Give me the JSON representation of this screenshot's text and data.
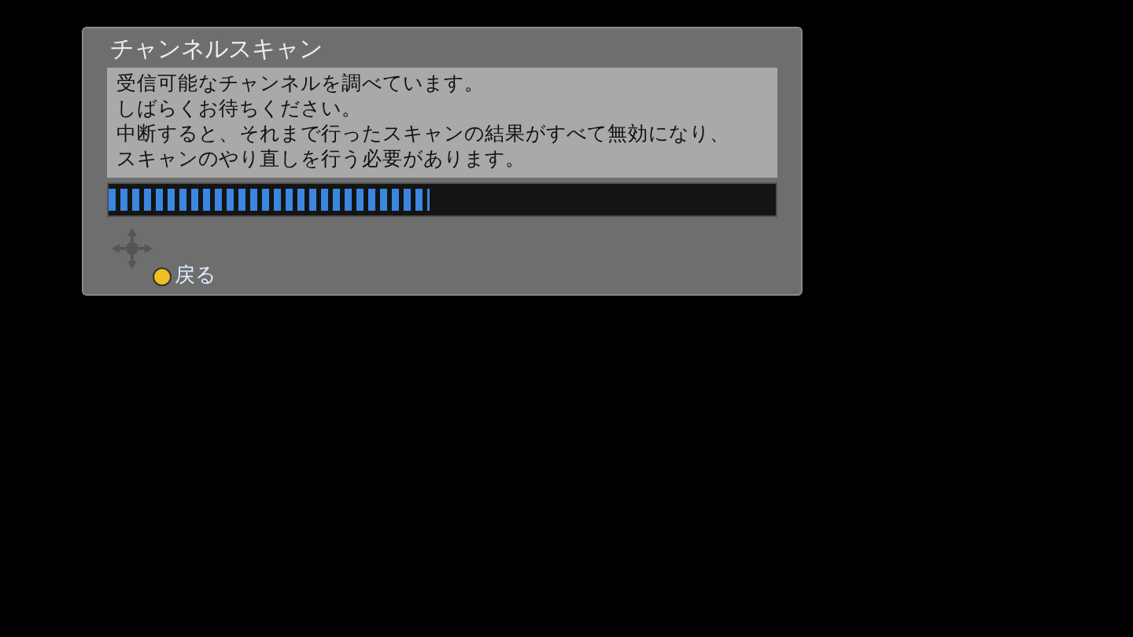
{
  "dialog": {
    "title": "チャンネルスキャン",
    "message_lines": [
      "受信可能なチャンネルを調べています。",
      "しばらくお待ちください。",
      "中断すると、それまで行ったスキャンの結果がすべて無効になり、",
      "スキャンのやり直しを行う必要があります。"
    ],
    "progress": {
      "level": 0.48
    },
    "hints": [
      {
        "label": "戻る",
        "color": "#f0c020"
      }
    ]
  }
}
